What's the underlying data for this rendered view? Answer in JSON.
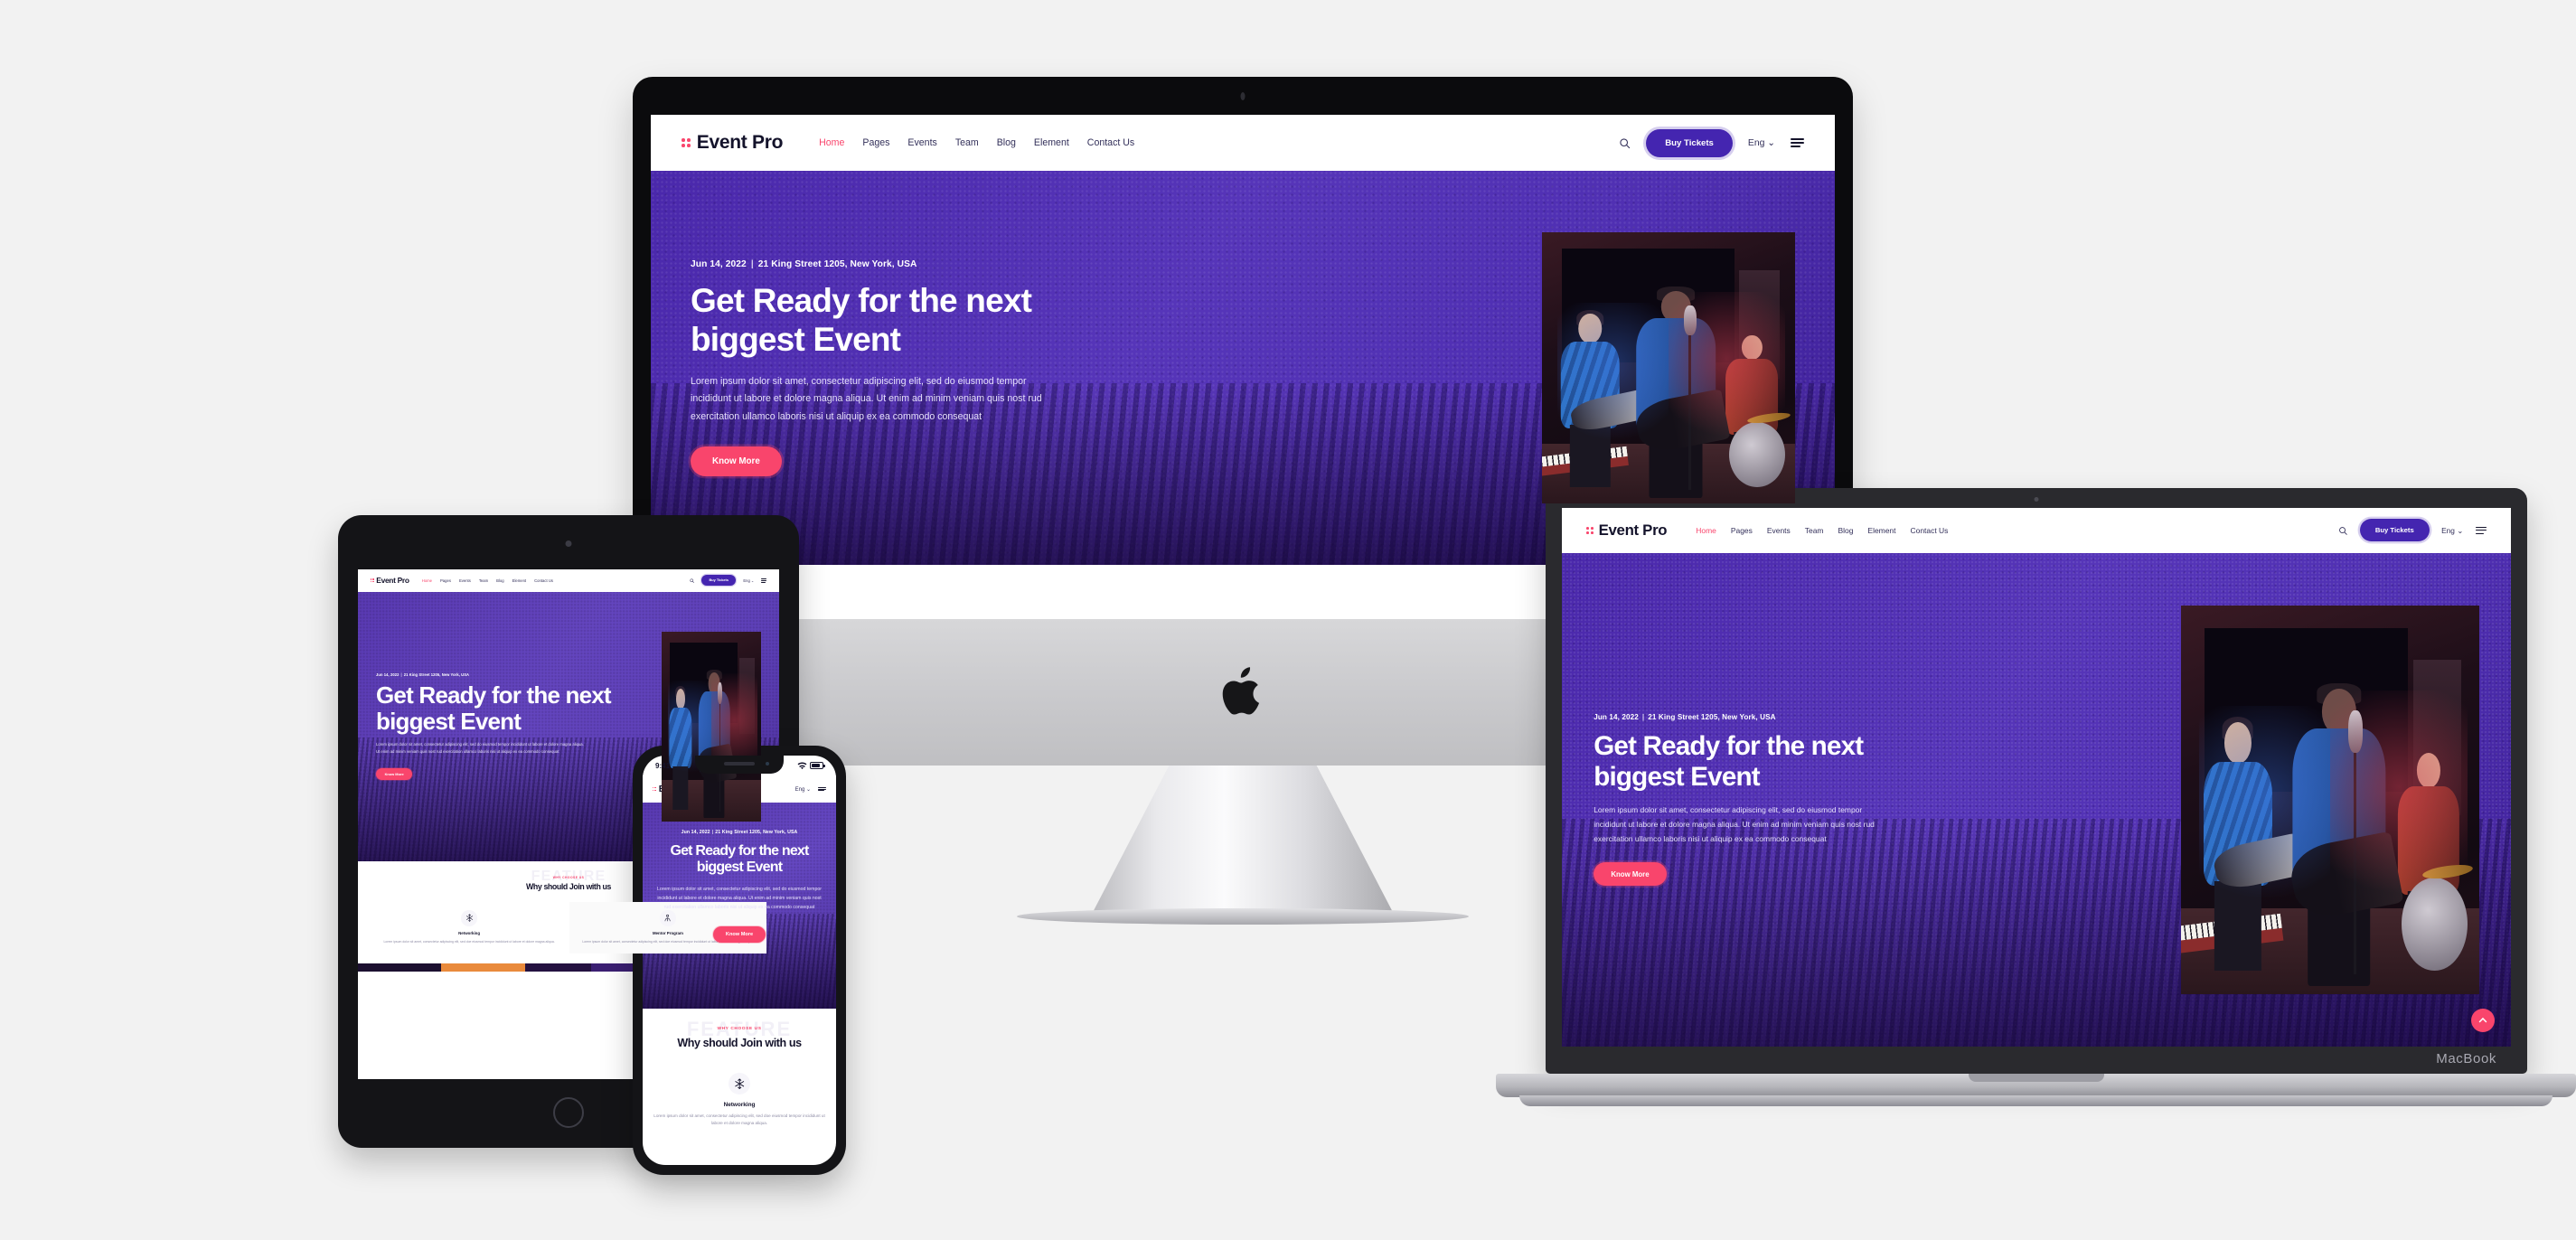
{
  "site": {
    "brand": "Event Pro",
    "nav": [
      {
        "label": "Home",
        "active": true
      },
      {
        "label": "Pages",
        "active": false
      },
      {
        "label": "Events",
        "active": false
      },
      {
        "label": "Team",
        "active": false
      },
      {
        "label": "Blog",
        "active": false
      },
      {
        "label": "Element",
        "active": false
      },
      {
        "label": "Contact Us",
        "active": false
      }
    ],
    "cta_label": "Buy Tickets",
    "language": "Eng",
    "search_icon": "search-icon",
    "menu_icon": "hamburger-menu-icon",
    "hero": {
      "date": "Jun 14, 2022",
      "separator": "|",
      "location": "21 King Street 1205, New York, USA",
      "title_line1": "Get Ready for the next",
      "title_line2": "biggest Event",
      "title_full": "Get Ready for the next biggest Event",
      "description": "Lorem ipsum dolor sit amet, consectetur adipiscing elit, sed do eiusmod tempor incididunt ut labore et dolore magna aliqua. Ut enim ad minim veniam quis nost rud exercitation ullamco laboris nisi ut aliquip ex ea commodo consequat",
      "cta_label": "Know More",
      "photo_alt": "band-performing-on-stage"
    },
    "features": {
      "watermark": "FEATURE",
      "eyebrow": "WHY CHOOSE US",
      "title": "Why should Join with us",
      "cards": [
        {
          "icon": "snowflake-icon",
          "name": "Networking",
          "text": "Lorem ipsum dolor sit amet, consectetur adipiscing elit, sed doe eiusmod tempor incididunt ut labore et dolore magna aliqua."
        },
        {
          "icon": "mentor-person-icon",
          "name": "Mentor Program",
          "text": "Lorem ipsum dolor sit amet, consectetur adipiscing elit, sed doe eiusmod tempor incididunt ut labore et dolore magna aliqua."
        }
      ]
    },
    "to_top_label": "scroll to top"
  },
  "phone": {
    "status_time": "9:41",
    "wifi_icon": "wifi-icon",
    "battery_icon": "battery-full-icon"
  },
  "devices": {
    "imac": {
      "name": "iMac",
      "logo": "apple-logo"
    },
    "macbook": {
      "name": "MacBook",
      "label": "MacBook"
    },
    "tablet": {
      "name": "iPad",
      "home_button": "home-button"
    },
    "phone": {
      "name": "iPhone"
    }
  },
  "colors": {
    "purple": "#4a28ab",
    "purple_deep": "#3d1f96",
    "pink": "#f9456c",
    "dark": "#14132b",
    "muted": "#8e8ca5",
    "page_bg": "#f2f2f2"
  }
}
